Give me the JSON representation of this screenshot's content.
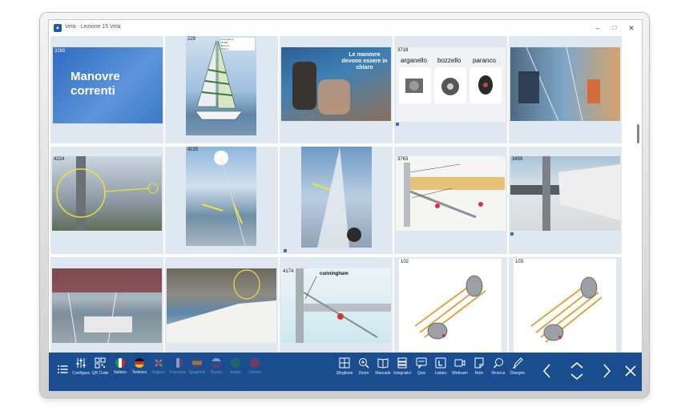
{
  "window": {
    "title": "Vela - Lezione 15 Vela",
    "icon": "app-logo-icon"
  },
  "controls": {
    "minimize": "–",
    "maximize": "□",
    "close": "✕"
  },
  "slides": [
    {
      "number": "3265",
      "title": "Manovre correnti"
    },
    {
      "number": "229",
      "sail_notes": [
        "Annodature ...",
        "Gratile ...",
        "Borosa ...",
        "Bugna ..."
      ]
    },
    {
      "number": "",
      "overlay_text": "Le manovre devono essere in chiaro"
    },
    {
      "number": "3718",
      "labels": [
        "arganello",
        "bozzello",
        "paranco"
      ]
    },
    {
      "number": ""
    },
    {
      "number": "4224"
    },
    {
      "number": "4225"
    },
    {
      "number": ""
    },
    {
      "number": "3763"
    },
    {
      "number": "3459"
    },
    {
      "number": ""
    },
    {
      "number": ""
    },
    {
      "number": "4174",
      "label": "cunningham"
    },
    {
      "number": "102"
    },
    {
      "number": "103"
    }
  ],
  "toolbar": {
    "left": [
      {
        "label": "",
        "icon": "list-icon"
      },
      {
        "label": "Configura",
        "icon": "settings-sliders-icon"
      },
      {
        "label": "QR Code",
        "icon": "qr-code-icon"
      }
    ],
    "languages": [
      {
        "label": "Italiano",
        "icon": "flag-italy-icon",
        "active": true
      },
      {
        "label": "Tedesco",
        "icon": "flag-germany-icon",
        "active": true
      },
      {
        "label": "Inglese",
        "icon": "flag-uk-icon",
        "active": false
      },
      {
        "label": "Francese",
        "icon": "flag-france-icon",
        "active": false
      },
      {
        "label": "Spagnolo",
        "icon": "flag-spain-icon",
        "active": false
      },
      {
        "label": "Russo",
        "icon": "flag-russia-icon",
        "active": false
      },
      {
        "label": "Arabo",
        "icon": "flag-arabic-icon",
        "active": false
      },
      {
        "label": "Cinese",
        "icon": "flag-china-icon",
        "active": false
      }
    ],
    "tools": [
      {
        "label": "Sfoglione",
        "icon": "grid-icon"
      },
      {
        "label": "Zoom",
        "icon": "zoom-icon"
      },
      {
        "label": "Manuale",
        "icon": "book-icon"
      },
      {
        "label": "Integrativi",
        "icon": "layers-icon"
      },
      {
        "label": "Quiz",
        "icon": "quiz-icon"
      },
      {
        "label": "Listato",
        "icon": "list-l-icon"
      },
      {
        "label": "Webcam",
        "icon": "webcam-icon"
      },
      {
        "label": "Note",
        "icon": "note-icon"
      },
      {
        "label": "Ricerca",
        "icon": "search-icon"
      },
      {
        "label": "Disegno",
        "icon": "pen-icon"
      }
    ],
    "navigation": [
      "previous-icon",
      "expand-collapse-icon",
      "next-icon",
      "close-icon"
    ]
  },
  "colors": {
    "toolbar": "#1a4d8f",
    "cell": "#dfe7f0",
    "slide_blue": "#3d7ac9"
  }
}
